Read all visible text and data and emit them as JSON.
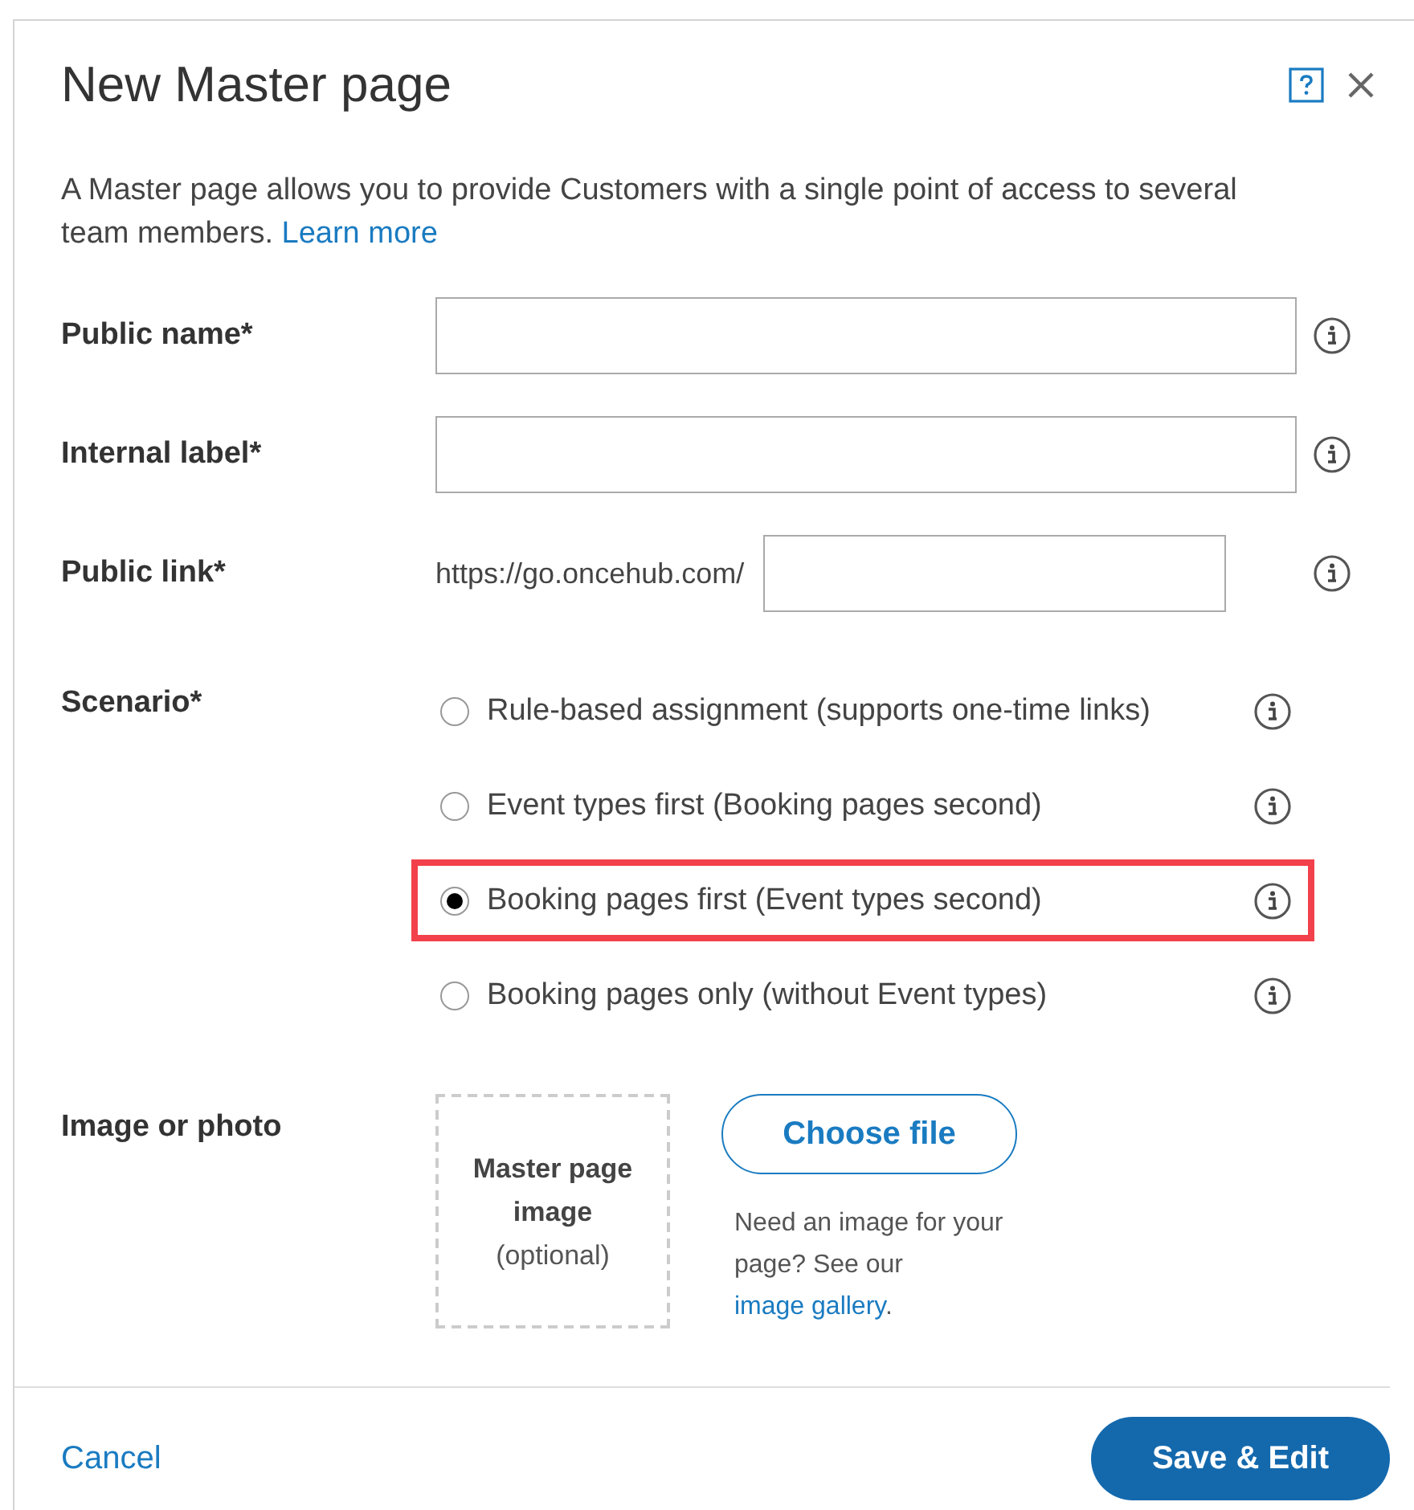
{
  "dialog": {
    "title": "New Master page",
    "description": "A Master page allows you to provide Customers with a single point of access to several team members.",
    "description_link": "Learn more"
  },
  "fields": [
    {
      "kind": "text",
      "label": "Public name*"
    },
    {
      "kind": "text",
      "label": "Internal label*"
    },
    {
      "kind": "prefixed",
      "label": "Public link*",
      "prefix": "https://go.oncehub.com/"
    }
  ],
  "scenario": {
    "label": "Scenario*",
    "options": [
      {
        "label": "Rule-based assignment (supports one-time links)",
        "selected": false,
        "highlighted": false
      },
      {
        "label": "Event types first (Booking pages second)",
        "selected": false,
        "highlighted": false
      },
      {
        "label": "Booking pages first (Event types second)",
        "selected": true,
        "highlighted": true
      },
      {
        "label": "Booking pages only (without Event types)",
        "selected": false,
        "highlighted": false
      }
    ]
  },
  "image": {
    "label": "Image or photo",
    "placeholder_title": "Master page image",
    "placeholder_note": "(optional)",
    "button": "Choose file",
    "help_text": "Need an image for your page? See our",
    "help_link": "image gallery",
    "help_end": "."
  },
  "footer": {
    "cancel": "Cancel",
    "save": "Save & Edit"
  }
}
